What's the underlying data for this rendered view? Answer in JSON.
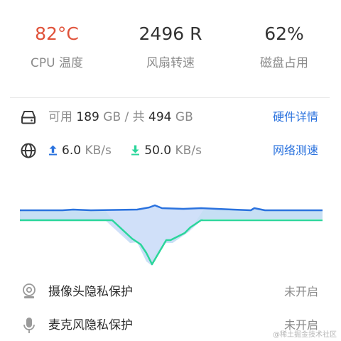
{
  "stats": [
    {
      "value": "82°C",
      "label": "CPU 温度",
      "color": "#e0533b"
    },
    {
      "value": "2496 R",
      "label": "风扇转速"
    },
    {
      "value": "62%",
      "label": "磁盘占用"
    }
  ],
  "disk": {
    "icon": "hard-drive-icon",
    "prefix": "可用",
    "available": "189",
    "unit1": "GB / 共",
    "total": "494",
    "unit2": "GB",
    "link": "硬件详情"
  },
  "network": {
    "icon": "globe-icon",
    "upload_value": "6.0",
    "upload_unit": "KB/s",
    "download_value": "50.0",
    "download_unit": "KB/s",
    "link": "网络测速",
    "upload_color": "#2a72de",
    "download_color": "#2bd69b"
  },
  "privacy": [
    {
      "icon": "camera-icon",
      "label": "摄像头隐私保护",
      "status": "未开启"
    },
    {
      "icon": "microphone-icon",
      "label": "麦克风隐私保护",
      "status": "未开启"
    }
  ],
  "watermark": "@稀土掘金技术社区"
}
